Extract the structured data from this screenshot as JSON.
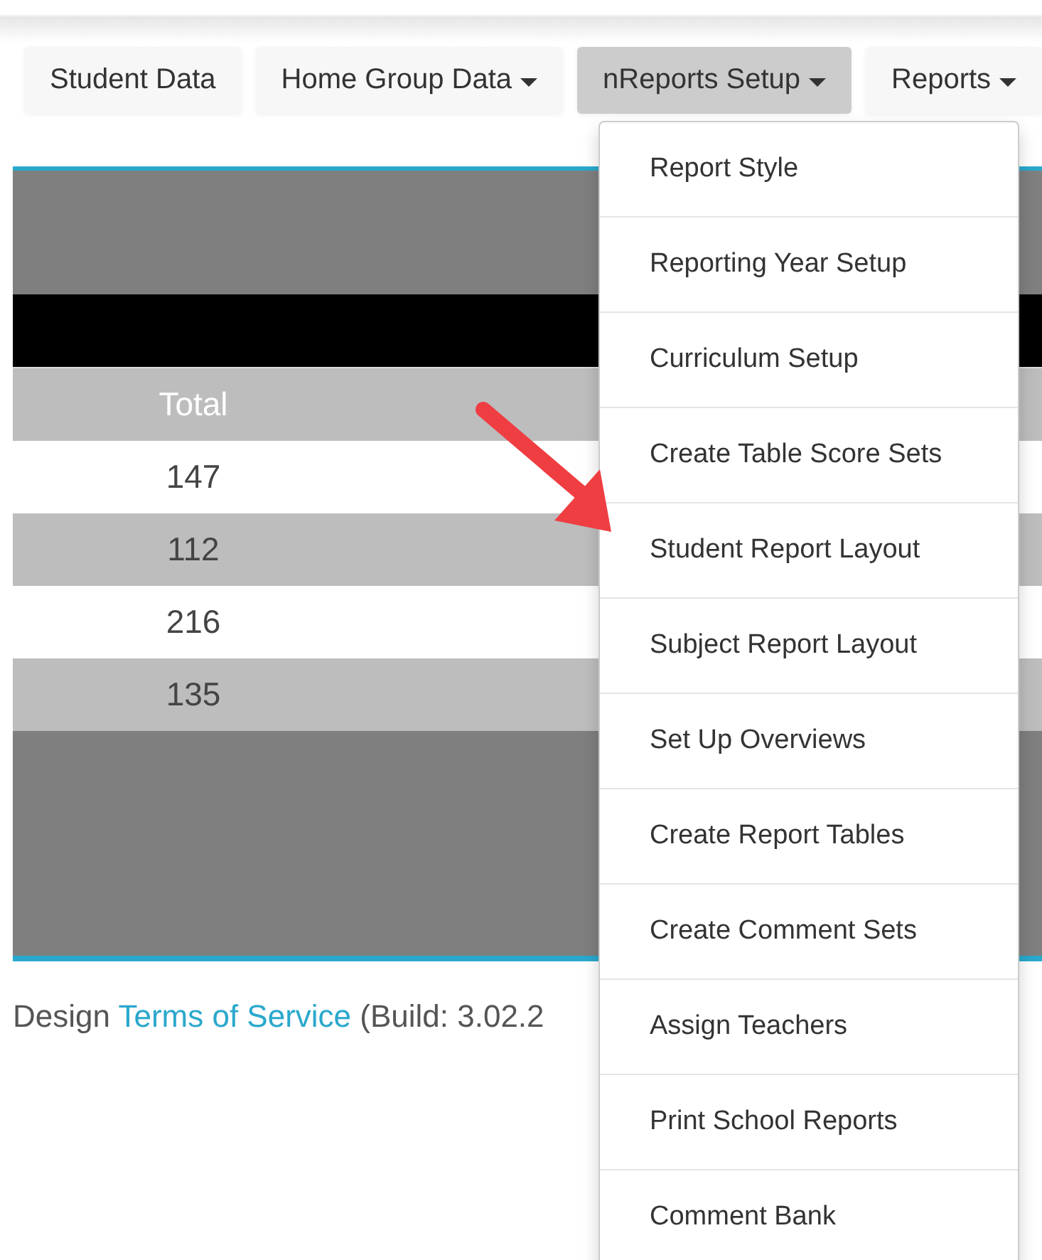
{
  "nav": [
    {
      "label": "Student Data",
      "selected": false,
      "dropdown": false
    },
    {
      "label": "Home Group Data",
      "selected": false,
      "dropdown": true
    },
    {
      "label": "nReports Setup",
      "selected": true,
      "dropdown": true
    },
    {
      "label": "Reports",
      "selected": false,
      "dropdown": true
    }
  ],
  "table": {
    "columns": [
      "Total"
    ],
    "rows": [
      [
        "147"
      ],
      [
        "112"
      ],
      [
        "216"
      ],
      [
        "135"
      ]
    ]
  },
  "footer": {
    "text_before": "Design",
    "link": "Terms of Service",
    "text_after": "(Build: 3.02.2"
  },
  "dropdown_menu": {
    "items": [
      "Report Style",
      "Reporting Year Setup",
      "Curriculum Setup",
      "Create Table Score Sets",
      "Student Report Layout",
      "Subject Report Layout",
      "Set Up Overviews",
      "Create Report Tables",
      "Create Comment Sets",
      "Assign Teachers",
      "Print School Reports",
      "Comment Bank"
    ]
  }
}
